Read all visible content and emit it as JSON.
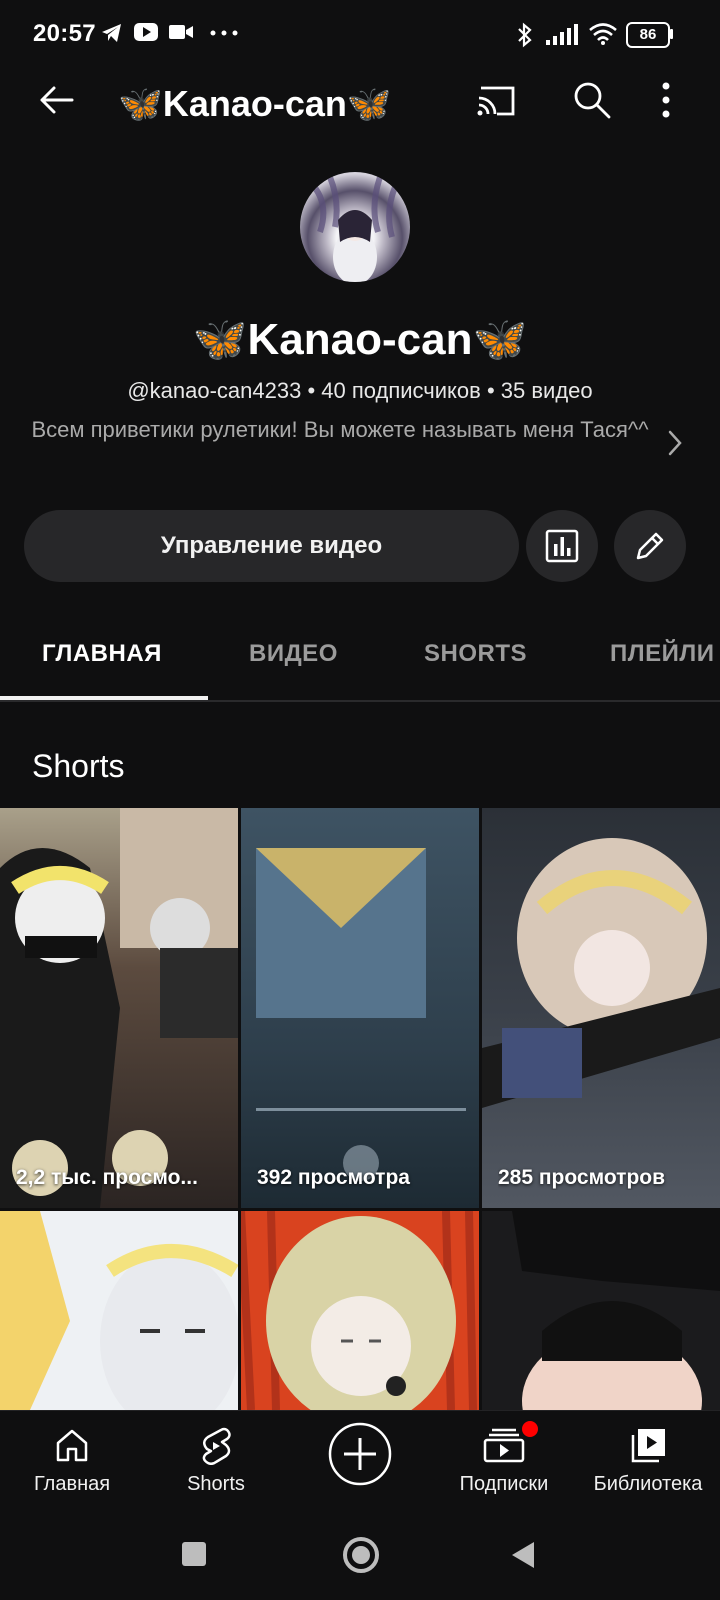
{
  "status_bar": {
    "time": "20:57",
    "battery": "86",
    "icons": [
      "telegram-icon",
      "youtube-icon",
      "video-call-icon",
      "more-dots-icon",
      "bluetooth-icon",
      "signal-icon",
      "wifi-icon",
      "battery-icon"
    ]
  },
  "header": {
    "title": "🦋Kanao-can🦋",
    "icons": [
      "back-arrow-icon",
      "cast-icon",
      "search-icon",
      "more-vertical-icon"
    ]
  },
  "channel": {
    "name": "🦋Kanao-can🦋",
    "meta": "@kanao-can4233 • 40 подписчиков • 35 видео",
    "description": "Всем приветики рулетики! Вы можете называть меня Тася^^",
    "actions": {
      "manage_label": "Управление видео",
      "icons": [
        "analytics-icon",
        "edit-pencil-icon"
      ]
    }
  },
  "tabs": {
    "items": [
      "ГЛАВНАЯ",
      "ВИДЕО",
      "SHORTS",
      "ПЛЕЙЛИ"
    ],
    "active": "ГЛАВНАЯ"
  },
  "shorts": {
    "heading": "Shorts",
    "items": [
      {
        "views": "2,2 тыс. просмо..."
      },
      {
        "views": "392 просмотра"
      },
      {
        "views": "285 просмотров"
      },
      {
        "views": ""
      },
      {
        "views": ""
      },
      {
        "views": ""
      }
    ]
  },
  "bottom_nav": {
    "items": [
      {
        "label": "Главная",
        "icon": "home-icon"
      },
      {
        "label": "Shorts",
        "icon": "shorts-icon"
      },
      {
        "label": "",
        "icon": "create-plus-icon"
      },
      {
        "label": "Подписки",
        "icon": "subscriptions-icon"
      },
      {
        "label": "Библиотека",
        "icon": "library-icon"
      }
    ]
  },
  "system_nav": {
    "icons": [
      "recents-square-icon",
      "home-circle-icon",
      "back-triangle-icon"
    ]
  },
  "colors": {
    "background": "#0f0f10",
    "button": "#272729",
    "notification": "#ff0000",
    "secondary_text": "#aaaaaa"
  }
}
